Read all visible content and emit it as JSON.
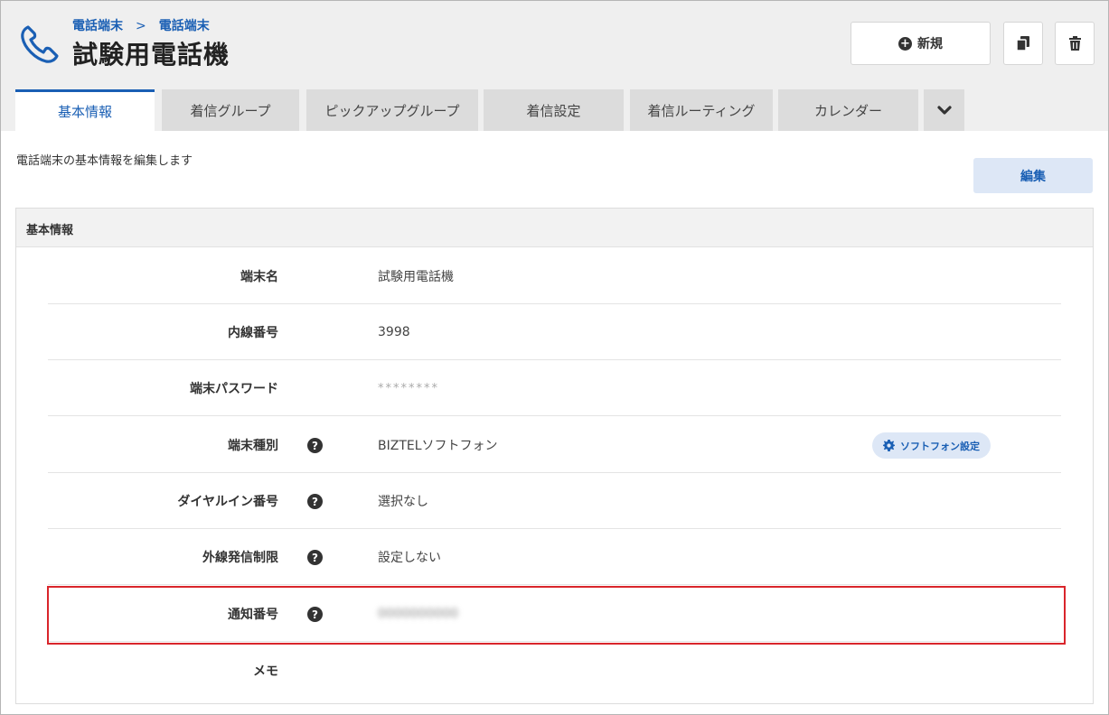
{
  "header": {
    "breadcrumb": [
      "電話端末",
      "電話端末"
    ],
    "breadcrumb_separator": ">",
    "title": "試験用電話機",
    "new_button_label": "新規",
    "icons": {
      "page": "phone-icon",
      "copy": "copy-icon",
      "delete": "trash-icon"
    }
  },
  "tabs": [
    {
      "label": "基本情報",
      "active": true
    },
    {
      "label": "着信グループ",
      "active": false
    },
    {
      "label": "ピックアップグループ",
      "active": false
    },
    {
      "label": "着信設定",
      "active": false
    },
    {
      "label": "着信ルーティング",
      "active": false
    },
    {
      "label": "カレンダー",
      "active": false
    }
  ],
  "main": {
    "description": "電話端末の基本情報を編集します",
    "edit_button_label": "編集"
  },
  "panel": {
    "title": "基本情報",
    "rows": [
      {
        "label": "端末名",
        "value": "試験用電話機",
        "help": false
      },
      {
        "label": "内線番号",
        "value": "3998",
        "help": false
      },
      {
        "label": "端末パスワード",
        "value": "********",
        "help": false
      },
      {
        "label": "端末種別",
        "value": "BIZTELソフトフォン",
        "help": true,
        "action_label": "ソフトフォン設定"
      },
      {
        "label": "ダイヤルイン番号",
        "value": "選択なし",
        "help": true
      },
      {
        "label": "外線発信制限",
        "value": "設定しない",
        "help": true
      },
      {
        "label": "通知番号",
        "value": "0000000000",
        "help": true,
        "blurred": true
      },
      {
        "label": "メモ",
        "value": "",
        "help": false
      }
    ]
  },
  "colors": {
    "accent": "#1a5fb4",
    "highlight": "#d9252b",
    "header_bg": "#efefef",
    "tab_bg": "#dcdcdc"
  }
}
